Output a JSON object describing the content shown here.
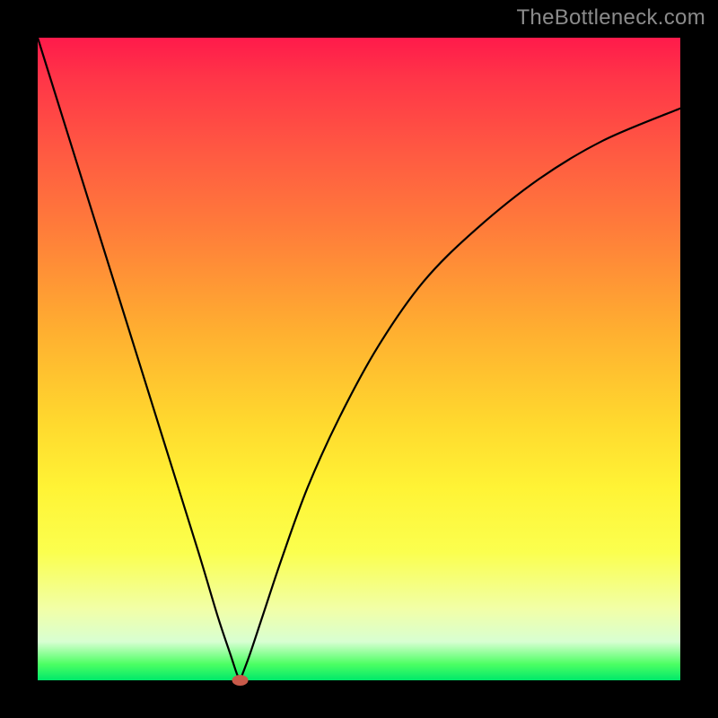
{
  "watermark": "TheBottleneck.com",
  "chart_data": {
    "type": "line",
    "title": "",
    "xlabel": "",
    "ylabel": "",
    "xlim": [
      0,
      100
    ],
    "ylim": [
      0,
      100
    ],
    "grid": false,
    "legend": false,
    "series": [
      {
        "name": "left-branch",
        "x": [
          0,
          5,
          10,
          15,
          20,
          25,
          28,
          30,
          31,
          31.5
        ],
        "values": [
          100,
          84,
          68,
          52,
          36,
          20,
          10,
          4,
          1,
          0
        ]
      },
      {
        "name": "right-branch",
        "x": [
          31.5,
          33,
          35,
          38,
          42,
          47,
          53,
          60,
          68,
          78,
          88,
          100
        ],
        "values": [
          0,
          4,
          10,
          19,
          30,
          41,
          52,
          62,
          70,
          78,
          84,
          89
        ]
      }
    ],
    "marker": {
      "name": "vertex-marker",
      "x": 31.5,
      "y": 0,
      "color": "#c85a4a"
    },
    "background_gradient": {
      "top": "#ff1a4b",
      "middle": "#ffd92e",
      "bottom": "#00e86a"
    }
  }
}
